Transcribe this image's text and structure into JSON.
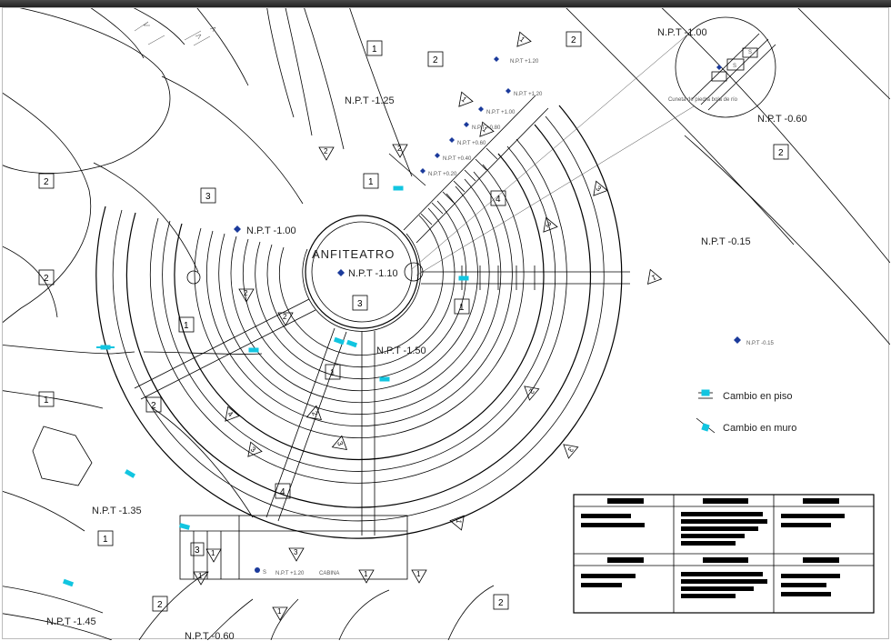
{
  "title": "ANFITEATRO",
  "labels": {
    "npt_center": "N.P.T -1.10",
    "npt_below": "N.P.T -1.50",
    "npt_left_100": "N.P.T -1.00",
    "npt_top_125": "N.P.T -1.25",
    "npt_top_100": "N.P.T -1.00",
    "npt_right_060": "N.P.T -0.60",
    "npt_right_015": "N.P.T -0.15",
    "npt_right_015b": "N.P.T -0.15",
    "npt_b_135": "N.P.T -1.35",
    "npt_b_145": "N.P.T -1.45",
    "npt_b_060": "N.P.T -0.60",
    "npt_cab_120": "N.P.T +1.20",
    "cabina": "CABINA",
    "detail_caption": "Cuneta de piedra bola de río",
    "npt_d_020": "N.P.T +0.20",
    "npt_d_040": "N.P.T +0.40",
    "npt_d_060": "N.P.T +0.60",
    "npt_d_080": "N.P.T +0.80",
    "npt_d_100": "N.P.T +1.00",
    "npt_d_120": "N.P.T +1.20"
  },
  "legend": {
    "item1": "Cambio en piso",
    "item2": "Cambio en muro"
  },
  "callouts": {
    "c1": "1",
    "c2": "2",
    "c3": "3",
    "c4": "4"
  }
}
